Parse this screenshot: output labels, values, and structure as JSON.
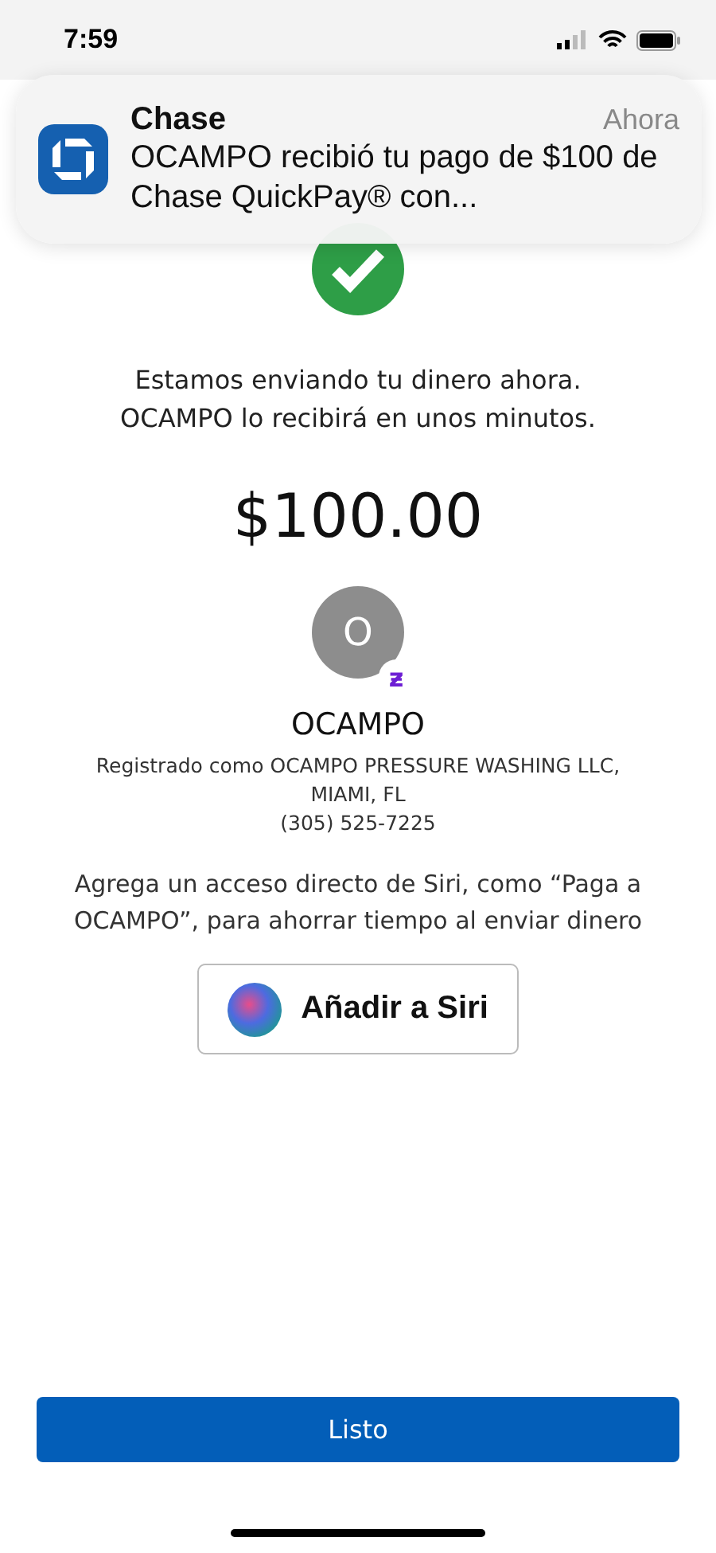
{
  "status_bar": {
    "time": "7:59"
  },
  "notification": {
    "app": "Chase",
    "time": "Ahora",
    "message": "OCAMPO recibió tu pago de $100 de Chase QuickPay® con..."
  },
  "confirmation": {
    "lines": [
      "Estamos enviando tu dinero ahora.",
      "OCAMPO lo recibirá en unos minutos."
    ],
    "amount": "$100.00"
  },
  "recipient": {
    "initial": "O",
    "badge": "ƶ",
    "name": "OCAMPO",
    "details": [
      "Registrado como OCAMPO PRESSURE WASHING LLC,",
      "MIAMI, FL",
      "(305) 525-7225"
    ]
  },
  "siri": {
    "hint": "Agrega un acceso directo de Siri, como “Paga a OCAMPO”, para ahorrar tiempo al enviar dinero",
    "button": "Añadir a Siri"
  },
  "done_button": "Listo"
}
